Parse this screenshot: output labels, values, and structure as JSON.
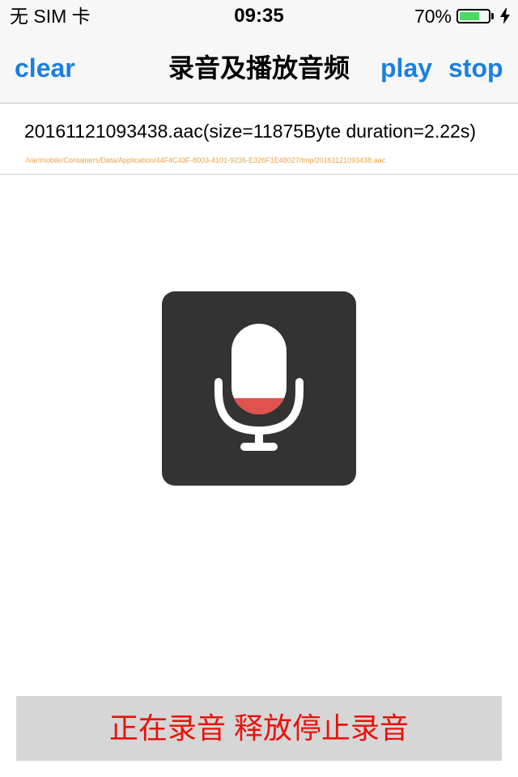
{
  "status_bar": {
    "carrier": "无 SIM 卡",
    "time": "09:35",
    "battery_percent_text": "70%",
    "battery_level": 0.7,
    "charging_icon": "lightning-bolt-icon",
    "battery_color": "#4cd964"
  },
  "nav": {
    "clear_label": "clear",
    "title": "录音及播放音频",
    "play_label": "play",
    "stop_label": "stop",
    "accent_color": "#1a7fe0"
  },
  "file": {
    "name_line": "20161121093438.aac(size=11875Byte duration=2.22s)",
    "path": "/var/mobile/Containers/Data/Application/44F4C43F-8003-4101-9236-E326F1E48027/tmp/20161121093438.aac"
  },
  "recorder": {
    "icon": "microphone-icon",
    "level": 0.18,
    "level_color": "#e0524d"
  },
  "record_button": {
    "label": "正在录音 释放停止录音",
    "text_color": "#e8120c"
  }
}
